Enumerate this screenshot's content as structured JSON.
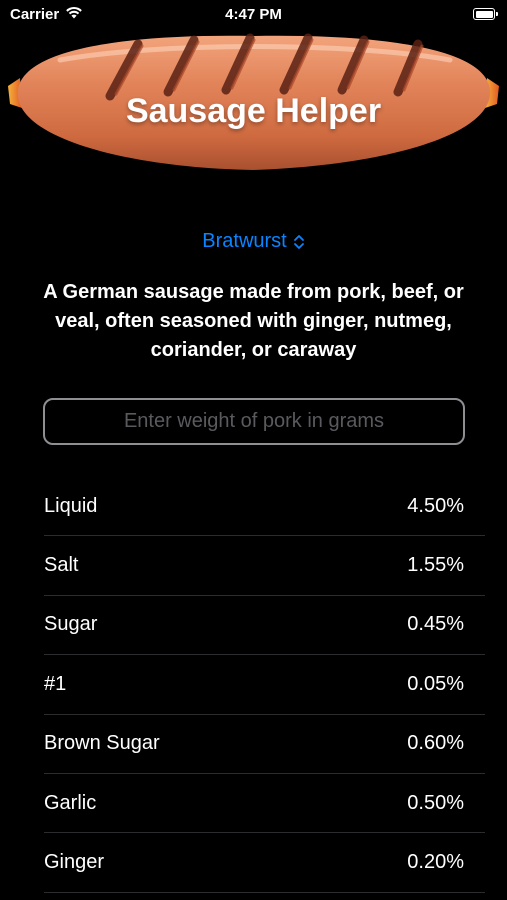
{
  "status_bar": {
    "carrier": "Carrier",
    "time": "4:47 PM",
    "wifi_icon": "wifi-icon",
    "battery_icon": "battery-icon"
  },
  "header": {
    "title": "Sausage Helper",
    "image": "sausage-image"
  },
  "sausage_picker": {
    "selected": "Bratwurst",
    "icon": "chevron-up-down-icon"
  },
  "description": "A German sausage made from pork, beef, or veal, often seasoned with ginger, nutmeg, coriander, or caraway",
  "weight_input": {
    "placeholder": "Enter weight of pork in grams",
    "value": ""
  },
  "ingredients": [
    {
      "name": "Liquid",
      "percent": "4.50%"
    },
    {
      "name": "Salt",
      "percent": "1.55%"
    },
    {
      "name": "Sugar",
      "percent": "0.45%"
    },
    {
      "name": "#1",
      "percent": "0.05%"
    },
    {
      "name": "Brown Sugar",
      "percent": "0.60%"
    },
    {
      "name": "Garlic",
      "percent": "0.50%"
    },
    {
      "name": "Ginger",
      "percent": "0.20%"
    }
  ],
  "colors": {
    "accent": "#0a84ff",
    "background": "#000000",
    "separator": "#2c2c2e",
    "sausage": "#d9774a"
  }
}
